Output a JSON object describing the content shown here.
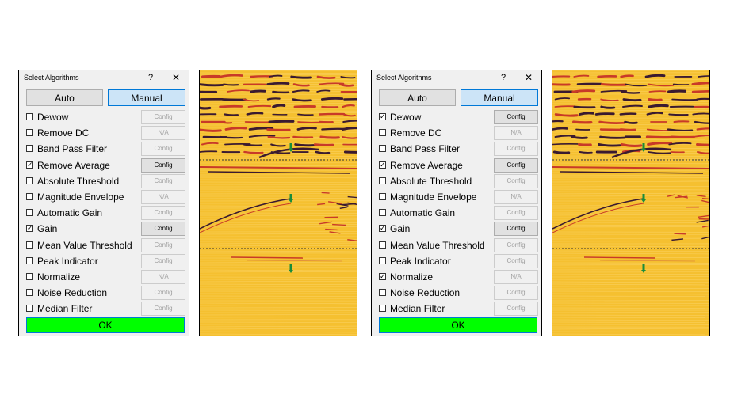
{
  "dialogs": [
    {
      "title": "Select Algorithms",
      "help": "?",
      "close": "✕",
      "auto_label": "Auto",
      "manual_label": "Manual",
      "ok_label": "OK",
      "algorithms": [
        {
          "name": "Dewow",
          "checked": false,
          "button": "Config",
          "enabled": false
        },
        {
          "name": "Remove DC",
          "checked": false,
          "button": "N/A",
          "enabled": false
        },
        {
          "name": "Band Pass Filter",
          "checked": false,
          "button": "Config",
          "enabled": false
        },
        {
          "name": "Remove Average",
          "checked": true,
          "button": "Config",
          "enabled": true
        },
        {
          "name": "Absolute Threshold",
          "checked": false,
          "button": "Config",
          "enabled": false
        },
        {
          "name": "Magnitude Envelope",
          "checked": false,
          "button": "N/A",
          "enabled": false
        },
        {
          "name": "Automatic Gain",
          "checked": false,
          "button": "Config",
          "enabled": false
        },
        {
          "name": "Gain",
          "checked": true,
          "button": "Config",
          "enabled": true
        },
        {
          "name": "Mean Value Threshold",
          "checked": false,
          "button": "Config",
          "enabled": false
        },
        {
          "name": "Peak Indicator",
          "checked": false,
          "button": "Config",
          "enabled": false
        },
        {
          "name": "Normalize",
          "checked": false,
          "button": "N/A",
          "enabled": false
        },
        {
          "name": "Noise Reduction",
          "checked": false,
          "button": "Config",
          "enabled": false
        },
        {
          "name": "Median Filter",
          "checked": false,
          "button": "Config",
          "enabled": false
        }
      ]
    },
    {
      "title": "Select Algorithms",
      "help": "?",
      "close": "✕",
      "auto_label": "Auto",
      "manual_label": "Manual",
      "ok_label": "OK",
      "algorithms": [
        {
          "name": "Dewow",
          "checked": true,
          "button": "Config",
          "enabled": true
        },
        {
          "name": "Remove DC",
          "checked": false,
          "button": "N/A",
          "enabled": false
        },
        {
          "name": "Band Pass Filter",
          "checked": false,
          "button": "Config",
          "enabled": false
        },
        {
          "name": "Remove Average",
          "checked": true,
          "button": "Config",
          "enabled": true
        },
        {
          "name": "Absolute Threshold",
          "checked": false,
          "button": "Config",
          "enabled": false
        },
        {
          "name": "Magnitude Envelope",
          "checked": false,
          "button": "N/A",
          "enabled": false
        },
        {
          "name": "Automatic Gain",
          "checked": false,
          "button": "Config",
          "enabled": false
        },
        {
          "name": "Gain",
          "checked": true,
          "button": "Config",
          "enabled": true
        },
        {
          "name": "Mean Value Threshold",
          "checked": false,
          "button": "Config",
          "enabled": false
        },
        {
          "name": "Peak Indicator",
          "checked": false,
          "button": "Config",
          "enabled": false
        },
        {
          "name": "Normalize",
          "checked": true,
          "button": "N/A",
          "enabled": false
        },
        {
          "name": "Noise Reduction",
          "checked": false,
          "button": "Config",
          "enabled": false
        },
        {
          "name": "Median Filter",
          "checked": false,
          "button": "Config",
          "enabled": false
        }
      ]
    }
  ],
  "colors": {
    "ok_green": "#00ff00",
    "manual_selected": "#cce4f7",
    "radar_background": "#f5c030",
    "radar_dark_band": "#3a1a30",
    "radar_red_band": "#c83a28",
    "marker_green": "#1a8c3a"
  },
  "icons": {
    "help": "help-icon",
    "close": "close-icon",
    "checkbox": "checkbox-icon",
    "marker": "marker-icon"
  }
}
